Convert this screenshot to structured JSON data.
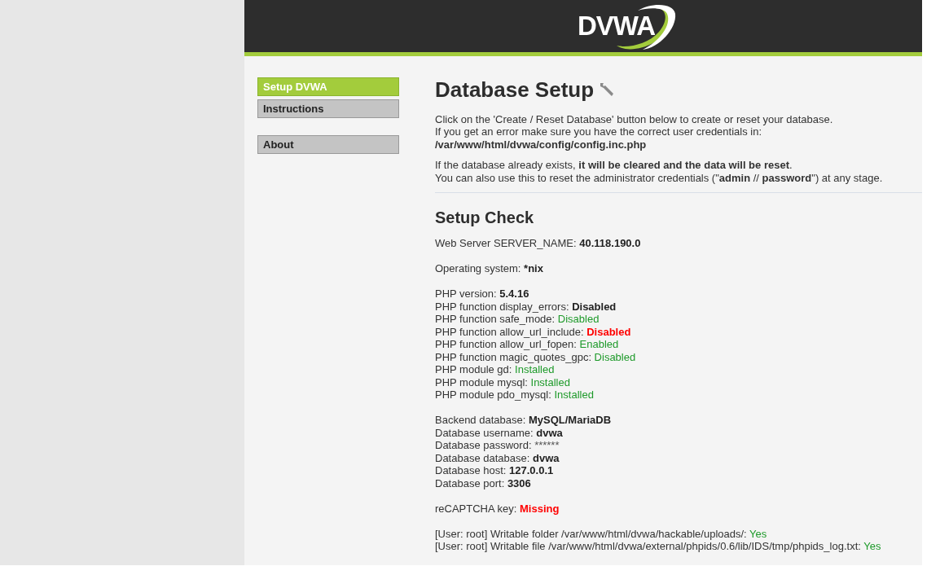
{
  "header": {
    "logo_text": "DVWA"
  },
  "sidebar": {
    "groups": [
      [
        {
          "label": "Setup DVWA",
          "selected": true
        },
        {
          "label": "Instructions",
          "selected": false
        }
      ],
      [
        {
          "label": "About",
          "selected": false
        }
      ]
    ]
  },
  "main": {
    "title": "Database Setup",
    "intro": [
      [
        "Click on the 'Create / Reset Database' button below to create or reset your database.",
        "If you get an error make sure you have the correct user credentials in:",
        "**/var/www/html/dvwa/config/config.inc.php**"
      ],
      [
        "If the database already exists, **it will be cleared and the data will be reset**.",
        "You can also use this to reset the administrator credentials (\"**admin** // **password**\") at any stage."
      ]
    ],
    "setup_check": {
      "title": "Setup Check",
      "groups": [
        [
          {
            "label": "Web Server SERVER_NAME: ",
            "value": "40.118.190.0",
            "kind": "emphasis"
          }
        ],
        [
          {
            "label": "Operating system: ",
            "value": "*nix",
            "kind": "emphasis"
          }
        ],
        [
          {
            "label": "PHP version: ",
            "value": "5.4.16",
            "kind": "emphasis"
          },
          {
            "label": "PHP function display_errors: ",
            "value": "Disabled",
            "kind": "emphasis"
          },
          {
            "label": "PHP function safe_mode: ",
            "value": "Disabled",
            "kind": "ok"
          },
          {
            "label": "PHP function allow_url_include: ",
            "value": "Disabled",
            "kind": "error"
          },
          {
            "label": "PHP function allow_url_fopen: ",
            "value": "Enabled",
            "kind": "ok"
          },
          {
            "label": "PHP function magic_quotes_gpc: ",
            "value": "Disabled",
            "kind": "ok"
          },
          {
            "label": "PHP module gd: ",
            "value": "Installed",
            "kind": "ok"
          },
          {
            "label": "PHP module mysql: ",
            "value": "Installed",
            "kind": "ok"
          },
          {
            "label": "PHP module pdo_mysql: ",
            "value": "Installed",
            "kind": "ok"
          }
        ],
        [
          {
            "label": "Backend database: ",
            "value": "MySQL/MariaDB",
            "kind": "emphasis"
          },
          {
            "label": "Database username: ",
            "value": "dvwa",
            "kind": "emphasis"
          },
          {
            "label": "Database password: ",
            "value": "******",
            "kind": "plain"
          },
          {
            "label": "Database database: ",
            "value": "dvwa",
            "kind": "emphasis"
          },
          {
            "label": "Database host: ",
            "value": "127.0.0.1",
            "kind": "emphasis"
          },
          {
            "label": "Database port: ",
            "value": "3306",
            "kind": "emphasis"
          }
        ],
        [
          {
            "label": "reCAPTCHA key: ",
            "value": "Missing",
            "kind": "error"
          }
        ],
        [
          {
            "label": "[User: root] Writable folder /var/www/html/dvwa/hackable/uploads/: ",
            "value": "Yes",
            "kind": "ok"
          },
          {
            "label": "[User: root] Writable file /var/www/html/dvwa/external/phpids/0.6/lib/IDS/tmp/phpids_log.txt: ",
            "value": "Yes",
            "kind": "ok"
          }
        ]
      ]
    }
  }
}
